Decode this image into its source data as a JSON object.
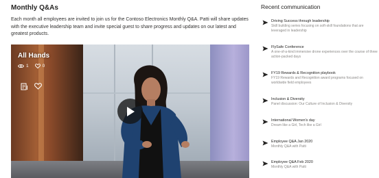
{
  "main": {
    "title": "Monthly Q&As",
    "description": "Each month all employees are invited to join us for the Contoso Electronics Monthly Q&A. Patti will share updates with the executive leadership team and invite special guest to share progress and updates on our latest and greatest products."
  },
  "video": {
    "title": "All Hands",
    "views": "1",
    "likes": "0",
    "icons": {
      "views": "eye-icon",
      "likes": "heart-icon",
      "transcript": "transcript-icon",
      "like_action": "heart-icon",
      "play": "play-icon"
    }
  },
  "sidebar": {
    "title": "Recent communication",
    "items": [
      {
        "title": "Driving Success through leadership",
        "subtitle": "Skill building series focusing on soft-skill foundations that are leveraged in leadership"
      },
      {
        "title": "FlySafe Conference",
        "subtitle": "A one-of-a-kind immersive drone experiences over the course of three action-packed days"
      },
      {
        "title": "FY19 Rewards & Recognition playbook",
        "subtitle": "FY19 Rewards and Recognition award programs focused on worldwide field employees"
      },
      {
        "title": "Inclusion & Diversity",
        "subtitle": "Panel discussion: Our Culture of Inclusion & Diversity"
      },
      {
        "title": "International Women's day",
        "subtitle": "Dream like a Girl, Tech like a Girl"
      },
      {
        "title": "Employee Q&A Jan 2020",
        "subtitle": "Monthly Q&A with Patti"
      },
      {
        "title": "Employee Q&A Feb 2020",
        "subtitle": "Monthly Q&A with Patti"
      }
    ],
    "item_icon": "send-arrow-icon"
  }
}
